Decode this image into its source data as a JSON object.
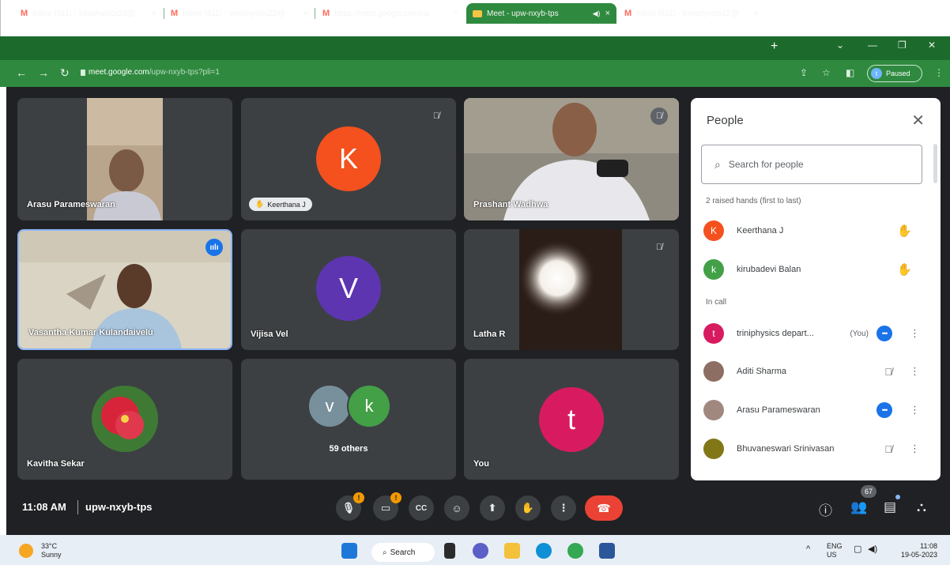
{
  "browser": {
    "tabs": [
      {
        "title": "Inbox (611) - triniphysics22@",
        "close": "×",
        "active": false
      },
      {
        "title": "Inbox (611) - triniphysics22@",
        "close": "×",
        "active": false
      },
      {
        "title": "https://meet.google.com/up",
        "close": "×",
        "active": false
      },
      {
        "title": "Meet - upw-nxyb-tps",
        "close": "×",
        "active": true
      },
      {
        "title": "Inbox (611) - triniphysics22@",
        "close": "×",
        "active": false
      }
    ],
    "gmail_glyph": "M",
    "new_tab": "+",
    "url_host": "meet.google.com",
    "url_path": "/upw-nxyb-tps?pli=1",
    "profile_initial": "t",
    "profile_status": "Paused"
  },
  "tiles": [
    {
      "name": "Arasu Parameswaran"
    },
    {
      "name": "Keerthana J",
      "initial": "K",
      "color": "#f4511e",
      "hand_raised": true
    },
    {
      "name": "Prashant Wadhwa"
    },
    {
      "name": "Vasantha Kumar Kulandaivelu",
      "speaking": true
    },
    {
      "name": "Vijisa Vel",
      "initial": "V",
      "color": "#5e35b1"
    },
    {
      "name": "Latha R"
    },
    {
      "name": "Kavitha Sekar"
    },
    {
      "name": "59 others",
      "initials": [
        "v",
        "k"
      ],
      "colors": [
        "#78909c",
        "#43a047"
      ]
    },
    {
      "name": "You",
      "initial": "t",
      "color": "#d81b60"
    }
  ],
  "people_panel": {
    "title": "People",
    "search_placeholder": "Search for people",
    "raised_hands_label": "2 raised hands (first to last)",
    "raised_hands": [
      {
        "name": "Keerthana J",
        "initial": "K",
        "color": "#f4511e"
      },
      {
        "name": "kirubadevi Balan",
        "initial": "k",
        "color": "#43a047"
      }
    ],
    "in_call_label": "In call",
    "in_call": [
      {
        "name": "triniphysics depart...",
        "you": "(You)",
        "initial": "t",
        "color": "#d81b60",
        "status": "speaking-dots"
      },
      {
        "name": "Aditi Sharma",
        "initial": "",
        "color": "#8d6e63",
        "status": "muted"
      },
      {
        "name": "Arasu Parameswaran",
        "initial": "",
        "color": "#a1887f",
        "status": "speaking-dots"
      },
      {
        "name": "Bhuvaneswari Srinivasan",
        "initial": "",
        "color": "#827717",
        "status": "muted"
      }
    ]
  },
  "controls": {
    "time": "11:08 AM",
    "meeting_code": "upw-nxyb-tps",
    "participant_count": "67",
    "warning_badge": "!"
  },
  "taskbar": {
    "temperature": "33°C",
    "weather": "Sunny",
    "search_label": "Search",
    "lang": "ENG",
    "region": "US",
    "clock_time": "11:08",
    "clock_date": "19-05-2023"
  }
}
